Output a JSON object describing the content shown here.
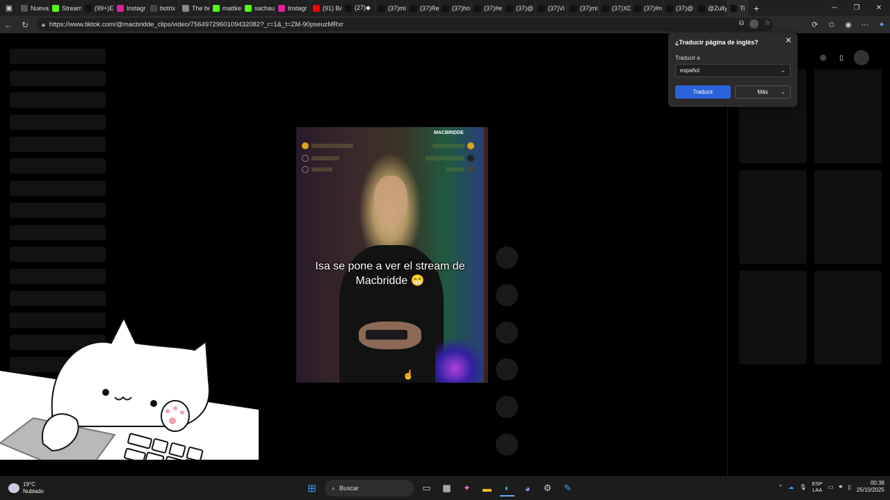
{
  "browser": {
    "tabs": [
      {
        "label": "Nueva",
        "color": "#555555"
      },
      {
        "label": "Stream",
        "color": "#53fc18"
      },
      {
        "label": "(99+)E",
        "color": "#111111"
      },
      {
        "label": "Instagr",
        "color": "#d6249f"
      },
      {
        "label": "botrix",
        "color": "#444444"
      },
      {
        "label": "The be",
        "color": "#888888"
      },
      {
        "label": "mattke",
        "color": "#53fc18"
      },
      {
        "label": "sachau",
        "color": "#53fc18"
      },
      {
        "label": "Instagr",
        "color": "#d6249f"
      },
      {
        "label": "(91) BA",
        "color": "#ff0000"
      },
      {
        "label": "(27)◆",
        "color": "#111111"
      },
      {
        "label": "(37)mi",
        "color": "#111111"
      },
      {
        "label": "(37)Re",
        "color": "#111111"
      },
      {
        "label": "(37)ho",
        "color": "#111111"
      },
      {
        "label": "(37)#e",
        "color": "#111111"
      },
      {
        "label": "(37)@",
        "color": "#111111"
      },
      {
        "label": "(37)Vi",
        "color": "#111111"
      },
      {
        "label": "(37)mi",
        "color": "#111111"
      },
      {
        "label": "(37)XD",
        "color": "#111111"
      },
      {
        "label": "(37)#n",
        "color": "#111111"
      },
      {
        "label": "(37)@",
        "color": "#111111"
      },
      {
        "label": "@Zully",
        "color": "#111111"
      },
      {
        "label": "Ti",
        "color": "#111111"
      }
    ],
    "url": "https://www.tiktok.com/@macbridde_clips/video/7564972960109432082?_r=1&_t=ZM-90pseuzMRxr"
  },
  "video": {
    "caption_line1": "Isa se pone a ver el stream de",
    "caption_line2": "Macbridde 😁",
    "brand": "MACBRIDDE"
  },
  "translate_popup": {
    "title": "¿Traducir página de inglés?",
    "label": "Traducir a",
    "selected_language": "español",
    "translate_button": "Traducir",
    "more_button": "Más"
  },
  "taskbar": {
    "weather_temp": "19°C",
    "weather_desc": "Nublado",
    "search_placeholder": "Buscar",
    "lang_line1": "ESP",
    "lang_line2": "LAA",
    "time": "00:38",
    "date": "25/10/2025"
  }
}
